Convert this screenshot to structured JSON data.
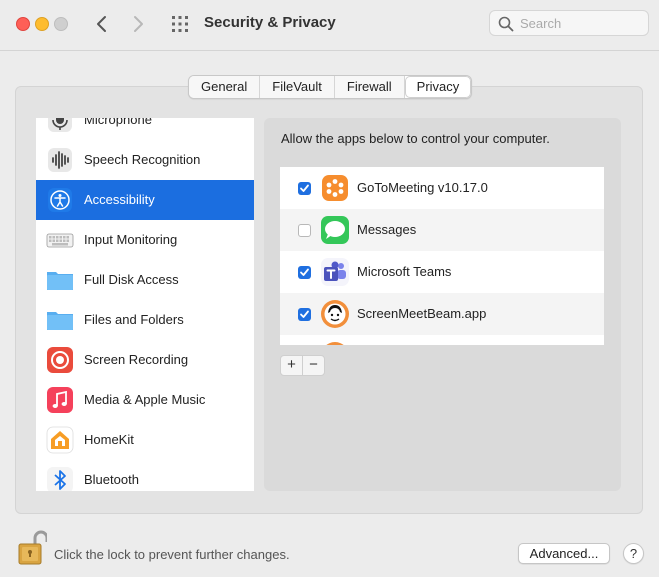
{
  "window": {
    "title": "Security & Privacy"
  },
  "search": {
    "placeholder": "Search"
  },
  "tabs": [
    {
      "label": "General",
      "active": false
    },
    {
      "label": "FileVault",
      "active": false
    },
    {
      "label": "Firewall",
      "active": false
    },
    {
      "label": "Privacy",
      "active": true
    }
  ],
  "sidebar": {
    "items": [
      {
        "label": "Microphone",
        "icon": "microphone-icon"
      },
      {
        "label": "Speech Recognition",
        "icon": "waveform-icon"
      },
      {
        "label": "Accessibility",
        "icon": "accessibility-icon",
        "selected": true
      },
      {
        "label": "Input Monitoring",
        "icon": "keyboard-icon"
      },
      {
        "label": "Full Disk Access",
        "icon": "folder-icon"
      },
      {
        "label": "Files and Folders",
        "icon": "folder-icon"
      },
      {
        "label": "Screen Recording",
        "icon": "record-icon"
      },
      {
        "label": "Media & Apple Music",
        "icon": "music-note-icon"
      },
      {
        "label": "HomeKit",
        "icon": "home-icon"
      },
      {
        "label": "Bluetooth",
        "icon": "bluetooth-icon"
      }
    ]
  },
  "main": {
    "description": "Allow the apps below to control your computer.",
    "apps": [
      {
        "name": "GoToMeeting v10.17.0",
        "checked": true,
        "icon": "gotomeeting-icon"
      },
      {
        "name": "Messages",
        "checked": false,
        "icon": "messages-icon"
      },
      {
        "name": "Microsoft Teams",
        "checked": true,
        "icon": "teams-icon"
      },
      {
        "name": "ScreenMeetBeam.app",
        "checked": true,
        "icon": "screenmeet-icon"
      }
    ],
    "add_label": "+",
    "remove_label": "−"
  },
  "footer": {
    "lock_text": "Click the lock to prevent further changes.",
    "advanced_label": "Advanced...",
    "help_label": "?"
  },
  "colors": {
    "accent": "#1b6ee0",
    "checkbox": "#1f6fe0",
    "traffic_red": "#fe5f57",
    "traffic_yellow": "#febc2e"
  }
}
